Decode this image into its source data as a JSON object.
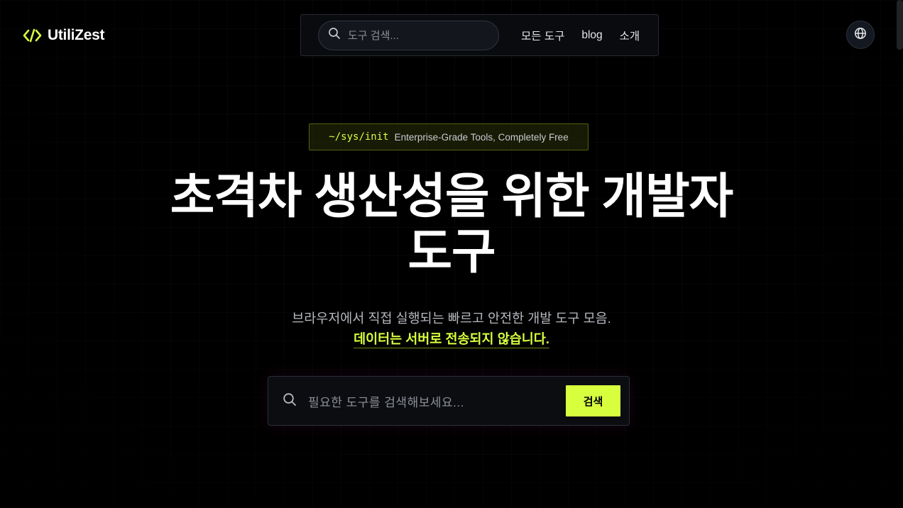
{
  "header": {
    "brand": "UtiliZest",
    "search_placeholder": "도구 검색...",
    "nav_links": [
      "모든 도구",
      "blog",
      "소개"
    ],
    "language_icon": "globe-icon"
  },
  "hero": {
    "badge_code": "~/sys/init",
    "badge_text": "Enterprise-Grade Tools, Completely Free",
    "title_line1": "초격차 생산성을 위한 개발자",
    "title_line2": "도구",
    "subtitle": "브라우저에서 직접 실행되는 빠르고 안전한 개발 도구 모음.",
    "highlight": "데이터는 서버로 전송되지 않습니다."
  },
  "search": {
    "placeholder": "필요한 도구를 검색해보세요...",
    "button_label": "검색"
  },
  "colors": {
    "accent": "#d8ff3e",
    "background": "#000000"
  }
}
